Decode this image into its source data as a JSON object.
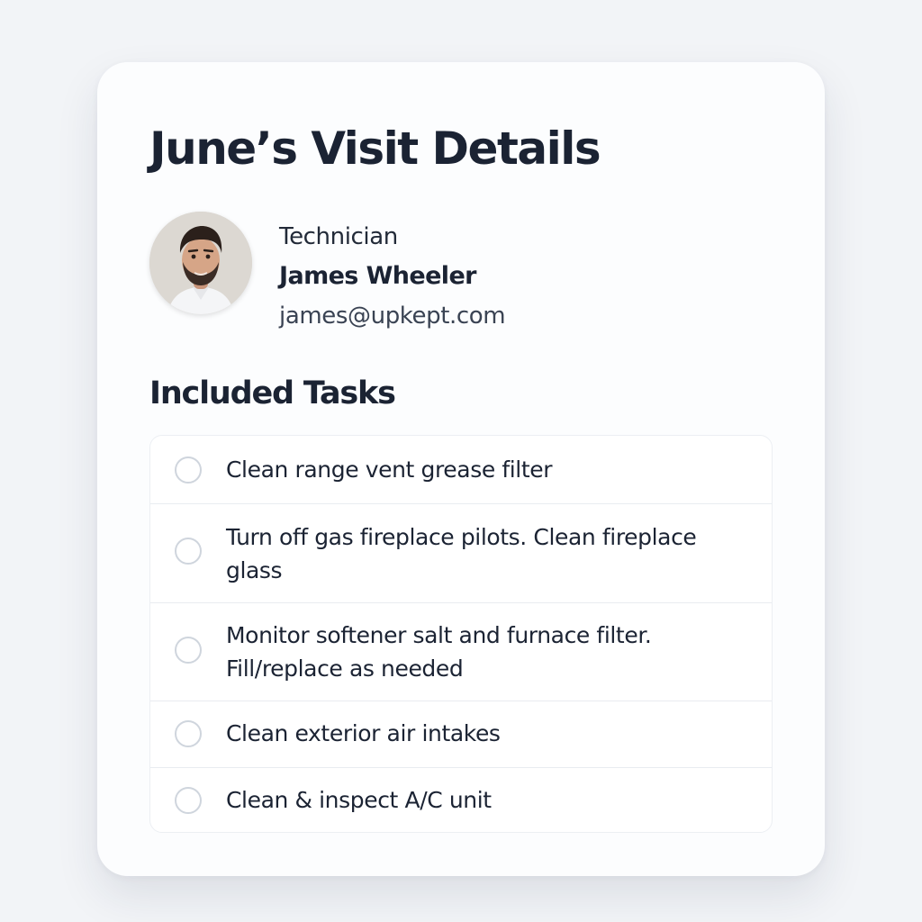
{
  "visit": {
    "title": "June’s Visit Details"
  },
  "technician": {
    "role_label": "Technician",
    "name": "James Wheeler",
    "email": "james@upkept.com",
    "avatar": "technician-photo"
  },
  "tasks_section": {
    "title": "Included Tasks",
    "check_icon": "empty-circle",
    "items": [
      {
        "label": "Clean range vent grease filter",
        "done": false
      },
      {
        "label": "Turn off gas fireplace pilots. Clean fireplace glass",
        "done": false
      },
      {
        "label": "Monitor softener salt and furnace filter. Fill/replace as needed",
        "done": false
      },
      {
        "label": "Clean exterior air intakes",
        "done": false
      },
      {
        "label": "Clean & inspect A/C unit",
        "done": false
      }
    ]
  },
  "colors": {
    "background": "#f2f4f7",
    "card": "#fcfdfe",
    "text": "#1b2333",
    "check_border": "#cfd5dd"
  }
}
